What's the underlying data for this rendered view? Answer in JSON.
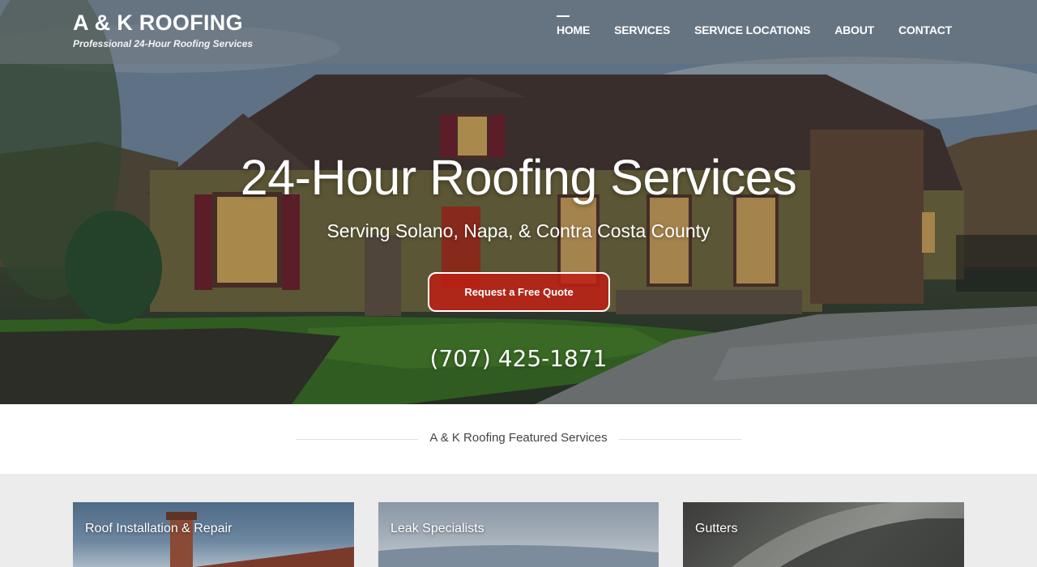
{
  "header": {
    "brand_title": "A & K ROOFING",
    "brand_tagline": "Professional 24-Hour Roofing Services"
  },
  "nav": {
    "items": [
      {
        "label": "HOME",
        "active": true
      },
      {
        "label": "SERVICES",
        "active": false
      },
      {
        "label": "SERVICE LOCATIONS",
        "active": false
      },
      {
        "label": "ABOUT",
        "active": false
      },
      {
        "label": "CONTACT",
        "active": false
      }
    ]
  },
  "hero": {
    "title": "24-Hour Roofing Services",
    "subtitle": "Serving Solano, Napa, & Contra Costa County",
    "cta_label": "Request a Free Quote",
    "phone": "(707) 425-1871"
  },
  "featured": {
    "heading": "A & K Roofing Featured Services",
    "cards": [
      {
        "label": "Roof Installation & Repair"
      },
      {
        "label": "Leak Specialists"
      },
      {
        "label": "Gutters"
      }
    ]
  },
  "colors": {
    "cta_red": "#be1e14",
    "header_overlay": "#6e7680",
    "section_bg": "#ececec"
  }
}
